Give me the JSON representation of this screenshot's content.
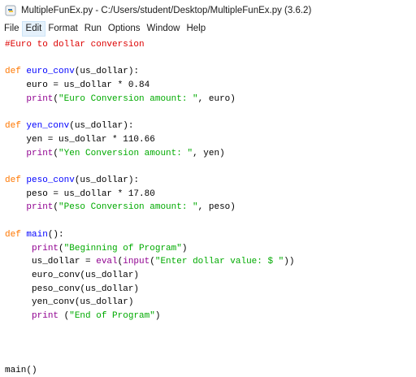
{
  "window": {
    "title": "MultipleFunEx.py - C:/Users/student/Desktop/MultipleFunEx.py (3.6.2)",
    "icon": "python-file-icon"
  },
  "menubar": {
    "items": [
      "File",
      "Edit",
      "Format",
      "Run",
      "Options",
      "Window",
      "Help"
    ],
    "active_index": 1
  },
  "colors": {
    "keyword": "#ff7700",
    "definition": "#0000ff",
    "string": "#00aa00",
    "comment": "#dd0000",
    "builtin": "#900090",
    "plain": "#000000"
  },
  "code": {
    "lines": [
      [
        {
          "t": "#Euro to dollar conversion",
          "c": "comment"
        }
      ],
      [],
      [
        {
          "t": "def ",
          "c": "kw"
        },
        {
          "t": "euro_conv",
          "c": "def"
        },
        {
          "t": "(us_dollar):",
          "c": "plain"
        }
      ],
      [
        {
          "t": "    euro = us_dollar * 0.84",
          "c": "plain"
        }
      ],
      [
        {
          "t": "    ",
          "c": "plain"
        },
        {
          "t": "print",
          "c": "builtin"
        },
        {
          "t": "(",
          "c": "plain"
        },
        {
          "t": "\"Euro Conversion amount: \"",
          "c": "str"
        },
        {
          "t": ", euro)",
          "c": "plain"
        }
      ],
      [],
      [
        {
          "t": "def ",
          "c": "kw"
        },
        {
          "t": "yen_conv",
          "c": "def"
        },
        {
          "t": "(us_dollar):",
          "c": "plain"
        }
      ],
      [
        {
          "t": "    yen = us_dollar * 110.66",
          "c": "plain"
        }
      ],
      [
        {
          "t": "    ",
          "c": "plain"
        },
        {
          "t": "print",
          "c": "builtin"
        },
        {
          "t": "(",
          "c": "plain"
        },
        {
          "t": "\"Yen Conversion amount: \"",
          "c": "str"
        },
        {
          "t": ", yen)",
          "c": "plain"
        }
      ],
      [],
      [
        {
          "t": "def ",
          "c": "kw"
        },
        {
          "t": "peso_conv",
          "c": "def"
        },
        {
          "t": "(us_dollar):",
          "c": "plain"
        }
      ],
      [
        {
          "t": "    peso = us_dollar * 17.80",
          "c": "plain"
        }
      ],
      [
        {
          "t": "    ",
          "c": "plain"
        },
        {
          "t": "print",
          "c": "builtin"
        },
        {
          "t": "(",
          "c": "plain"
        },
        {
          "t": "\"Peso Conversion amount: \"",
          "c": "str"
        },
        {
          "t": ", peso)",
          "c": "plain"
        }
      ],
      [],
      [
        {
          "t": "def ",
          "c": "kw"
        },
        {
          "t": "main",
          "c": "def"
        },
        {
          "t": "():",
          "c": "plain"
        }
      ],
      [
        {
          "t": "     ",
          "c": "plain"
        },
        {
          "t": "print",
          "c": "builtin"
        },
        {
          "t": "(",
          "c": "plain"
        },
        {
          "t": "\"Beginning of Program\"",
          "c": "str"
        },
        {
          "t": ")",
          "c": "plain"
        }
      ],
      [
        {
          "t": "     us_dollar = ",
          "c": "plain"
        },
        {
          "t": "eval",
          "c": "builtin"
        },
        {
          "t": "(",
          "c": "plain"
        },
        {
          "t": "input",
          "c": "builtin"
        },
        {
          "t": "(",
          "c": "plain"
        },
        {
          "t": "\"Enter dollar value: $ \"",
          "c": "str"
        },
        {
          "t": "))",
          "c": "plain"
        }
      ],
      [
        {
          "t": "     euro_conv(us_dollar)",
          "c": "plain"
        }
      ],
      [
        {
          "t": "     peso_conv(us_dollar)",
          "c": "plain"
        }
      ],
      [
        {
          "t": "     yen_conv(us_dollar)",
          "c": "plain"
        }
      ],
      [
        {
          "t": "     ",
          "c": "plain"
        },
        {
          "t": "print",
          "c": "builtin"
        },
        {
          "t": " (",
          "c": "plain"
        },
        {
          "t": "\"End of Program\"",
          "c": "str"
        },
        {
          "t": ")",
          "c": "plain"
        }
      ],
      [],
      [],
      [],
      [
        {
          "t": "main()",
          "c": "plain"
        }
      ]
    ]
  }
}
